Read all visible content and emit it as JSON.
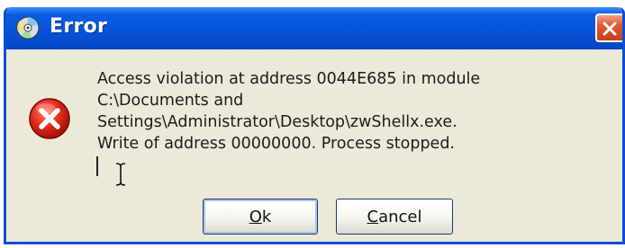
{
  "window": {
    "title": "Error",
    "accent_color": "#0553d8",
    "close_color": "#dd5a32"
  },
  "icons": {
    "title_icon": "cd-disc-icon",
    "message_icon": "error-x-icon",
    "close_icon": "close-icon"
  },
  "message": {
    "lines": [
      "Access violation at address 0044E685 in module",
      "C:\\Documents and",
      "Settings\\Administrator\\Desktop\\zwShellx.exe.",
      "Write of address 00000000. Process stopped."
    ]
  },
  "buttons": {
    "ok": {
      "accel": "O",
      "rest": "k"
    },
    "cancel": {
      "accel": "C",
      "rest": "ancel"
    }
  }
}
